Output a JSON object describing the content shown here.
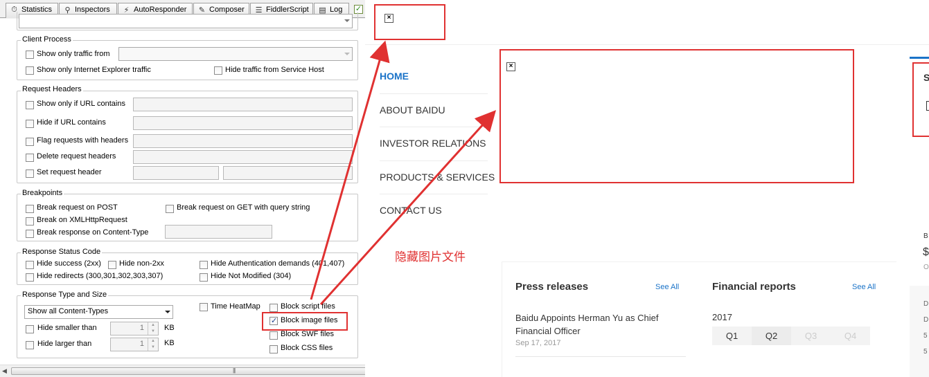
{
  "tabs": [
    {
      "label": "Statistics",
      "icon": "stopwatch-icon"
    },
    {
      "label": "Inspectors",
      "icon": "inspectors-icon"
    },
    {
      "label": "AutoResponder",
      "icon": "lightning-icon"
    },
    {
      "label": "Composer",
      "icon": "compose-icon"
    },
    {
      "label": "FiddlerScript",
      "icon": "script-icon"
    },
    {
      "label": "Log",
      "icon": "log-icon"
    }
  ],
  "client_process": {
    "title": "Client Process",
    "only_traffic_from": "Show only traffic from",
    "only_ie": "Show only Internet Explorer traffic",
    "hide_service_host": "Hide traffic from Service Host"
  },
  "request_headers": {
    "title": "Request Headers",
    "url_contains": "Show only if URL contains",
    "hide_url": "Hide if URL contains",
    "flag_headers": "Flag requests with headers",
    "delete_headers": "Delete request headers",
    "set_header": "Set request header"
  },
  "breakpoints": {
    "title": "Breakpoints",
    "post": "Break request on POST",
    "get_query": "Break request on GET with query string",
    "xhr": "Break on XMLHttpRequest",
    "content_type": "Break response on Content-Type"
  },
  "response_status": {
    "title": "Response Status Code",
    "hide_success": "Hide success (2xx)",
    "hide_non2xx": "Hide non-2xx",
    "hide_auth": "Hide Authentication demands (401,407)",
    "hide_redirects": "Hide redirects (300,301,302,303,307)",
    "hide_not_modified": "Hide Not Modified (304)"
  },
  "response_type": {
    "title": "Response Type and Size",
    "content_types_selected": "Show all Content-Types",
    "time_heatmap": "Time HeatMap",
    "block_script": "Block script files",
    "block_image": "Block image files",
    "block_image_checked": true,
    "block_swf": "Block SWF files",
    "block_css": "Block CSS files",
    "hide_smaller": "Hide smaller than",
    "hide_larger": "Hide larger than",
    "smaller_value": "1",
    "larger_value": "1",
    "unit": "KB"
  },
  "baidu": {
    "nav": [
      "HOME",
      "ABOUT BAIDU",
      "INVESTOR RELATIONS",
      "PRODUCTS & SERVICES",
      "CONTACT US"
    ],
    "annotation": "隐藏图片文件",
    "press": {
      "title": "Press releases",
      "see_all": "See All",
      "headline_line1": "Baidu Appoints Herman Yu as Chief",
      "headline_line2": "Financial Officer",
      "date": "Sep 17, 2017"
    },
    "financial": {
      "title": "Financial reports",
      "see_all": "See All",
      "year": "2017",
      "quarters": [
        "Q1",
        "Q2",
        "Q3",
        "Q4"
      ]
    },
    "right_edge": [
      "S",
      "B",
      "$",
      "O",
      "D",
      "D",
      "5",
      "5"
    ]
  },
  "colors": {
    "annotation_red": "#e03131",
    "link_blue": "#1a73c8"
  }
}
